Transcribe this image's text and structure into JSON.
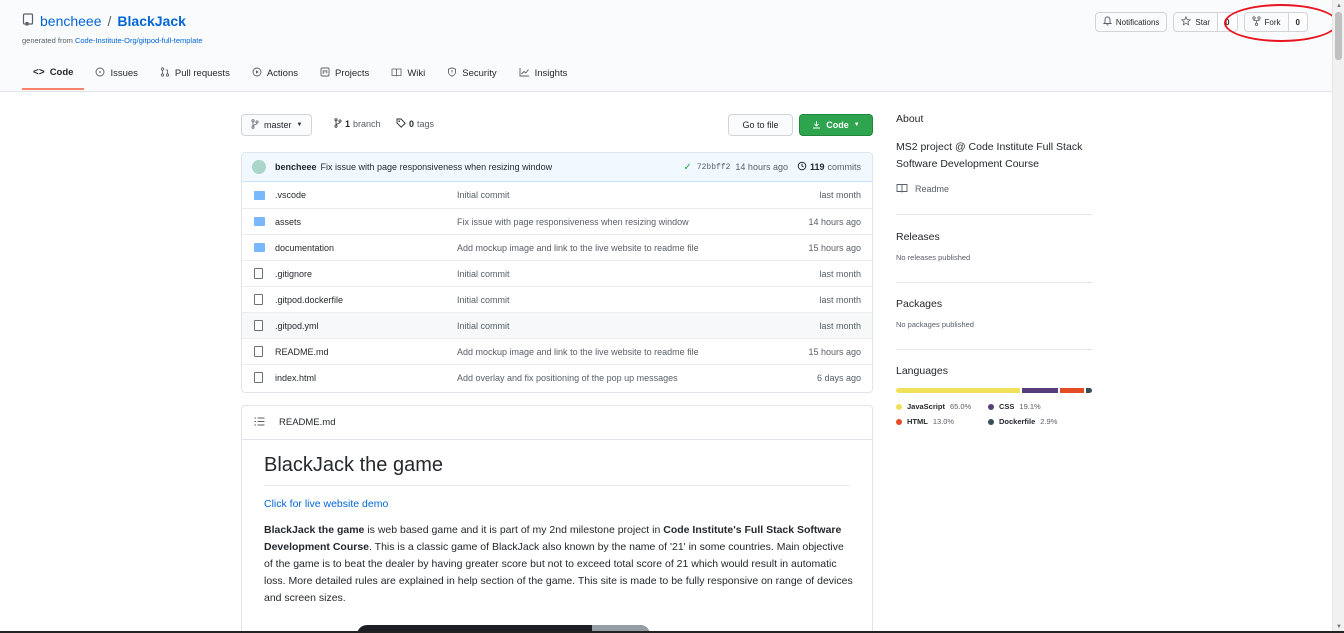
{
  "repo": {
    "owner": "bencheee",
    "separator": "/",
    "name": "BlackJack",
    "generated_prefix": "generated from ",
    "generated_link": "Code-Institute-Org/gitpod-full-template"
  },
  "header_buttons": {
    "notifications": "Notifications",
    "star": "Star",
    "star_count": "0",
    "fork": "Fork",
    "fork_count": "0"
  },
  "tabs": [
    {
      "label": "Code",
      "icon": "code-icon"
    },
    {
      "label": "Issues",
      "icon": "issue-icon"
    },
    {
      "label": "Pull requests",
      "icon": "pull-request-icon"
    },
    {
      "label": "Actions",
      "icon": "play-icon"
    },
    {
      "label": "Projects",
      "icon": "project-icon"
    },
    {
      "label": "Wiki",
      "icon": "book-icon"
    },
    {
      "label": "Security",
      "icon": "shield-icon"
    },
    {
      "label": "Insights",
      "icon": "graph-icon"
    }
  ],
  "toolbar": {
    "branch": "master",
    "branch_count": "1",
    "branch_label": "branch",
    "tag_count": "0",
    "tag_label": "tags",
    "go_to_file": "Go to file",
    "code": "Code"
  },
  "latest_commit": {
    "author": "bencheee",
    "message": "Fix issue with page responsiveness when resizing window",
    "sha": "72bbff2",
    "time": "14 hours ago",
    "commit_count": "119",
    "commits_label": "commits"
  },
  "files": [
    {
      "type": "folder",
      "name": ".vscode",
      "message": "Initial commit",
      "age": "last month"
    },
    {
      "type": "folder",
      "name": "assets",
      "message": "Fix issue with page responsiveness when resizing window",
      "age": "14 hours ago"
    },
    {
      "type": "folder",
      "name": "documentation",
      "message": "Add mockup image and link to the live website to readme file",
      "age": "15 hours ago"
    },
    {
      "type": "file",
      "name": ".gitignore",
      "message": "Initial commit",
      "age": "last month"
    },
    {
      "type": "file",
      "name": ".gitpod.dockerfile",
      "message": "Initial commit",
      "age": "last month"
    },
    {
      "type": "file",
      "name": ".gitpod.yml",
      "message": "Initial commit",
      "age": "last month"
    },
    {
      "type": "file",
      "name": "README.md",
      "message": "Add mockup image and link to the live website to readme file",
      "age": "15 hours ago"
    },
    {
      "type": "file",
      "name": "index.html",
      "message": "Add overlay and fix positioning of the pop up messages",
      "age": "6 days ago"
    }
  ],
  "readme": {
    "filename": "README.md",
    "title": "BlackJack the game",
    "live_link": "Click for live website demo",
    "para_bold1": "BlackJack the game",
    "para_text1": " is web based game and it is part of my 2nd milestone project in ",
    "para_bold2": "Code Institute's Full Stack Software Development Course",
    "para_text2": ". This is a classic game of BlackJack also known by the name of '21' in some countries. Main objective of the game is to beat the dealer by having greater score but not to exceed total score of 21 which would result in automatic loss. More detailed rules are explained in help section of the game. This site is made to be fully responsive on range of devices and screen sizes."
  },
  "sidebar": {
    "about_title": "About",
    "about_text": "MS2 project @ Code Institute Full Stack Software Development Course",
    "readme_link": "Readme",
    "releases_title": "Releases",
    "releases_text": "No releases published",
    "packages_title": "Packages",
    "packages_text": "No packages published",
    "languages_title": "Languages",
    "languages": [
      {
        "name": "JavaScript",
        "percent": "65.0%",
        "value": 65.0,
        "color": "#f1e05a"
      },
      {
        "name": "CSS",
        "percent": "19.1%",
        "value": 19.1,
        "color": "#563d7c"
      },
      {
        "name": "HTML",
        "percent": "13.0%",
        "value": 13.0,
        "color": "#e34c26"
      },
      {
        "name": "Dockerfile",
        "percent": "2.9%",
        "value": 2.9,
        "color": "#384d54"
      }
    ]
  }
}
